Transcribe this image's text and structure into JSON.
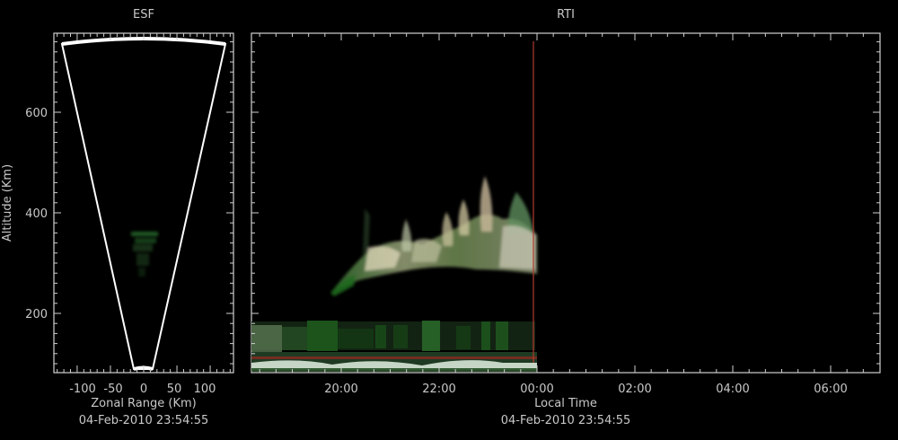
{
  "esf": {
    "title": "ESF",
    "ylabel": "Altitude (Km)",
    "xlabel": "Zonal Range (Km)",
    "timestamp": "04-Feb-2010 23:54:55",
    "yticks": [
      "200",
      "400",
      "600"
    ],
    "xticks": [
      "-100",
      "-50",
      "0",
      "50",
      "100"
    ]
  },
  "rti": {
    "title": "RTI",
    "xlabel": "Local Time",
    "timestamp": "04-Feb-2010 23:54:55",
    "yticks": [
      "200",
      "400",
      "600"
    ],
    "xticks": [
      "20:00",
      "22:00",
      "00:00",
      "02:00",
      "04:00",
      "06:00"
    ]
  },
  "chart_data": [
    {
      "type": "heatmap",
      "title": "ESF",
      "xlabel": "Zonal Range (Km)",
      "ylabel": "Altitude (Km)",
      "xlim": [
        -135,
        135
      ],
      "ylim": [
        80,
        750
      ],
      "x_ticks": [
        -100,
        -50,
        0,
        50,
        100
      ],
      "y_ticks": [
        200,
        400,
        600
      ],
      "fan_sector_edge_color": "#ffffff",
      "echo_color": "#2e7d32",
      "timestamp": "04-Feb-2010 23:54:55"
    },
    {
      "type": "heatmap",
      "title": "RTI",
      "xlabel": "Local Time",
      "ylabel": "Altitude (Km)",
      "x_ticks": [
        "20:00",
        "22:00",
        "00:00",
        "02:00",
        "04:00",
        "06:00"
      ],
      "y_ticks": [
        200,
        400,
        600
      ],
      "ylim": [
        80,
        750
      ],
      "current_time_marker": "23:54",
      "marker_color": "#b03a2e",
      "echo_color": "#3f8f3f",
      "timestamp": "04-Feb-2010 23:54:55"
    }
  ]
}
